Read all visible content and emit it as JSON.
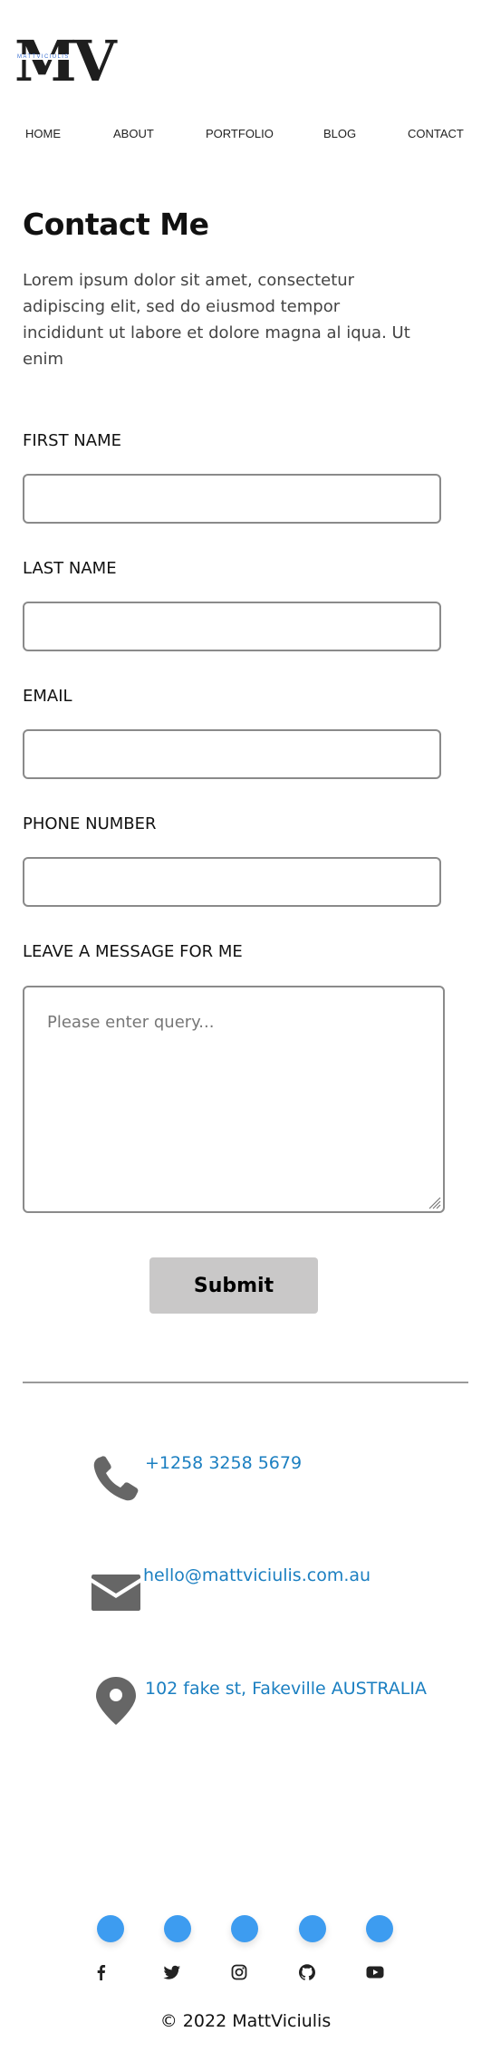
{
  "logo": {
    "mark": "MV",
    "wordmark": "MATTVICIULIS"
  },
  "nav": {
    "items": [
      "HOME",
      "ABOUT",
      "PORTFOLIO",
      "BLOG",
      "CONTACT"
    ]
  },
  "page": {
    "title": "Contact Me",
    "intro": "Lorem ipsum dolor sit amet, consectetur adipiscing elit, sed do eiusmod tempor incididunt ut labore et dolore magna al iqua. Ut enim"
  },
  "form": {
    "first_name_label": "FIRST NAME",
    "first_name_value": "",
    "last_name_label": "LAST NAME",
    "last_name_value": "",
    "email_label": "EMAIL",
    "email_value": "",
    "phone_label": "PHONE NUMBER",
    "phone_value": "",
    "message_label": "LEAVE A MESSAGE FOR ME",
    "message_placeholder": "Please enter query...",
    "submit_label": "Submit"
  },
  "contact": {
    "phone": "+1258 3258 5679",
    "email": "hello@mattviciulis.com.au",
    "address": "102 fake st, Fakeville AUSTRALIA"
  },
  "social": {
    "icons": [
      "facebook-icon",
      "twitter-icon",
      "instagram-icon",
      "github-icon",
      "youtube-icon"
    ],
    "accent": "#3d9cf0"
  },
  "footer": {
    "copyright": "© 2022 MattViciulis"
  },
  "colors": {
    "link": "#1b7fc1",
    "button": "#c9c8c8",
    "icon": "#666666"
  }
}
